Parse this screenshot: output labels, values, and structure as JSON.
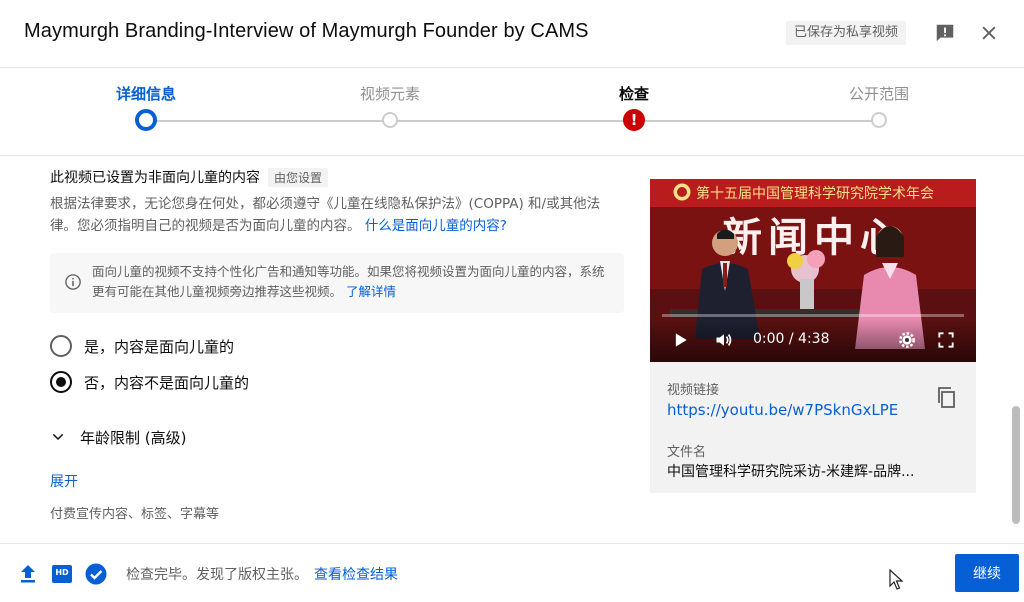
{
  "header": {
    "title": "Maymurgh Branding-Interview of Maymurgh Founder by CAMS",
    "saved_badge": "已保存为私享视频"
  },
  "steps": [
    {
      "label": "详细信息",
      "state": "active"
    },
    {
      "label": "视频元素",
      "state": "default"
    },
    {
      "label": "检查",
      "state": "error"
    },
    {
      "label": "公开范围",
      "state": "default"
    }
  ],
  "audience": {
    "heading": "此视频已设置为非面向儿童的内容",
    "set_by": "由您设置",
    "law_text": "根据法律要求，无论您身在何处，都必须遵守《儿童在线隐私保护法》(COPPA) 和/或其他法律。您必须指明自己的视频是否为面向儿童的内容。",
    "law_link": "什么是面向儿童的内容?",
    "info_text": "面向儿童的视频不支持个性化广告和通知等功能。如果您将视频设置为面向儿童的内容，系统更有可能在其他儿童视频旁边推荐这些视频。",
    "info_link": "了解详情",
    "option_yes": "是，内容是面向儿童的",
    "option_no": "否，内容不是面向儿童的",
    "selected": "no",
    "age_restriction": "年龄限制 (高级)",
    "expand": "展开",
    "extra": "付费宣传内容、标签、字幕等"
  },
  "video": {
    "banner_text": "第十五届中国管理科学研究院学术年会",
    "big_text": "新闻中心",
    "time": "0:00 / 4:38",
    "progress": 0,
    "link_label": "视频链接",
    "link": "https://youtu.be/w7PSknGxLPE",
    "filename_label": "文件名",
    "filename": "中国管理科学研究院采访-米建辉-品牌..."
  },
  "footer": {
    "status_text": "检查完毕。发现了版权主张。",
    "status_link": "查看检查结果",
    "continue_label": "继续",
    "hd_badge": "HD"
  },
  "colors": {
    "accent": "#065fd4",
    "error": "#cc0000"
  }
}
